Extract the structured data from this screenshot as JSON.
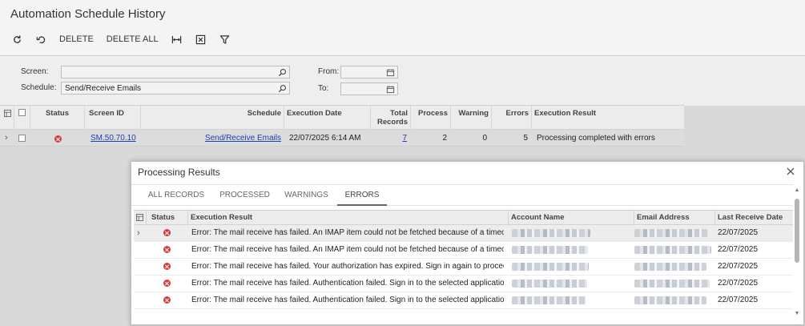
{
  "page": {
    "title": "Automation Schedule History"
  },
  "toolbar": {
    "refresh_icon": "refresh-icon",
    "undo_icon": "undo-icon",
    "delete_label": "DELETE",
    "delete_all_label": "DELETE ALL",
    "fit_icon": "fit-columns-icon",
    "excel_icon": "excel-export-icon",
    "filter_icon": "filter-icon"
  },
  "filters": {
    "screen_label": "Screen:",
    "screen_value": "",
    "schedule_label": "Schedule:",
    "schedule_value": "Send/Receive Emails",
    "from_label": "From:",
    "from_value": "",
    "to_label": "To:",
    "to_value": ""
  },
  "grid": {
    "headers": {
      "status": "Status",
      "screen_id": "Screen ID",
      "schedule": "Schedule",
      "execution_date": "Execution Date",
      "total_records_1": "Total",
      "total_records_2": "Records",
      "process": "Process",
      "warning": "Warning",
      "errors": "Errors",
      "execution_result": "Execution Result"
    },
    "row": {
      "status": "error",
      "screen_id": "SM.50.70.10",
      "schedule": "Send/Receive Emails",
      "execution_date": "22/07/2025 6:14 AM",
      "total_records": "7",
      "process": "2",
      "warning": "0",
      "errors": "5",
      "execution_result": "Processing completed with errors"
    }
  },
  "modal": {
    "title": "Processing Results",
    "tabs": [
      "ALL RECORDS",
      "PROCESSED",
      "WARNINGS",
      "ERRORS"
    ],
    "active_tab": "ERRORS",
    "headers": {
      "status": "Status",
      "execution_result": "Execution Result",
      "account_name": "Account Name",
      "email_address": "Email Address",
      "last_receive_date": "Last Receive Date"
    },
    "rows": [
      {
        "result": "Error: The mail receive has failed. An IMAP item could not be fetched because of a timeout ...",
        "date": "22/07/2025"
      },
      {
        "result": "Error: The mail receive has failed. An IMAP item could not be fetched because of a timeout ...",
        "date": "22/07/2025"
      },
      {
        "result": "Error: The mail receive has failed. Your authorization has expired. Sign in again to proceed.",
        "date": "22/07/2025"
      },
      {
        "result": "Error: The mail receive has failed. Authentication failed. Sign in to the selected application.",
        "date": "22/07/2025"
      },
      {
        "result": "Error: The mail receive has failed. Authentication failed. Sign in to the selected application.",
        "date": "22/07/2025"
      }
    ]
  },
  "colors": {
    "error": "#d93a3a",
    "link": "#1a3fb0"
  }
}
